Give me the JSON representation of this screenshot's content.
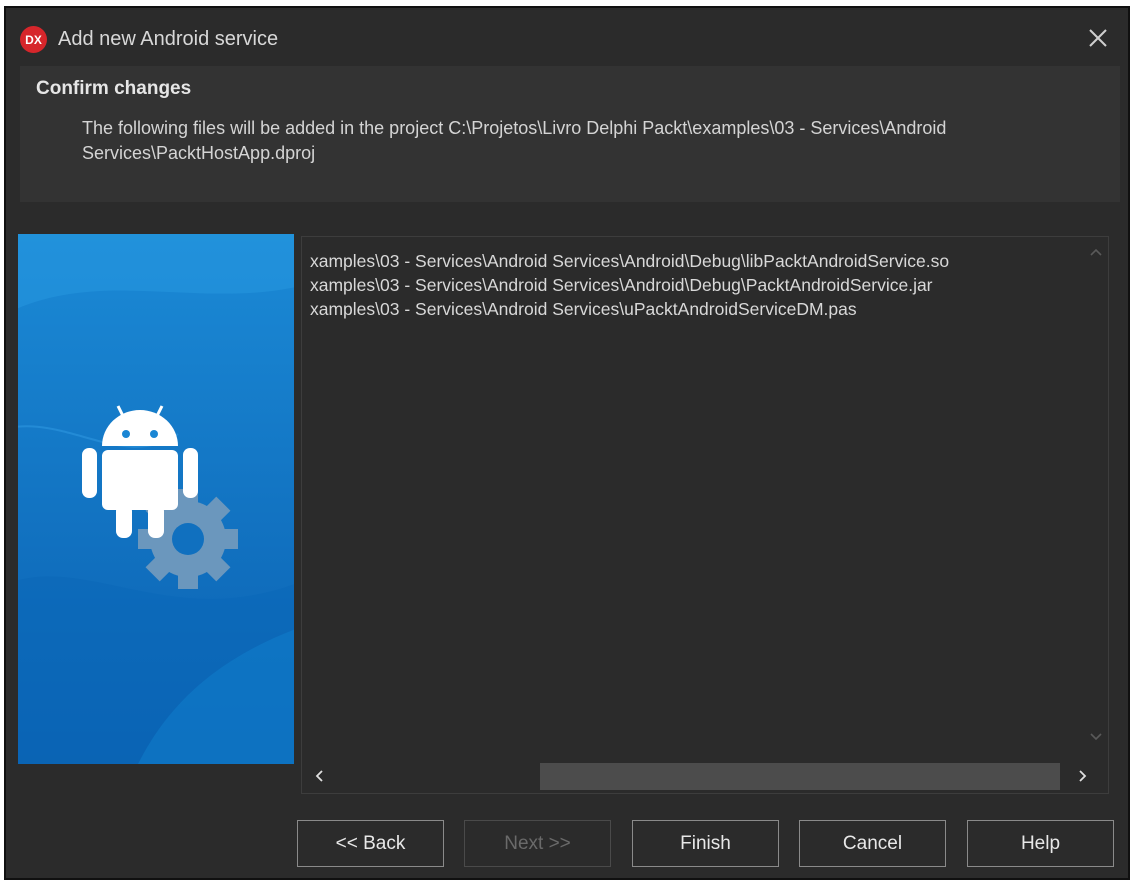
{
  "window": {
    "title": "Add new Android service",
    "app_logo": "DX",
    "close_icon": "close-icon"
  },
  "header": {
    "title": "Confirm changes",
    "description": "The following files will be added in the project C:\\Projetos\\Livro Delphi Packt\\examples\\03 - Services\\Android Services\\PacktHostApp.dproj"
  },
  "files": [
    "xamples\\03 - Services\\Android Services\\Android\\Debug\\libPacktAndroidService.so",
    "xamples\\03 - Services\\Android Services\\Android\\Debug\\PacktAndroidService.jar",
    "xamples\\03 - Services\\Android Services\\uPacktAndroidServiceDM.pas"
  ],
  "buttons": {
    "back": "<< Back",
    "next": "Next >>",
    "finish": "Finish",
    "cancel": "Cancel",
    "help": "Help"
  },
  "colors": {
    "background": "#2b2b2b",
    "banner_blue": "#1588d6",
    "logo_red": "#d6262b"
  }
}
